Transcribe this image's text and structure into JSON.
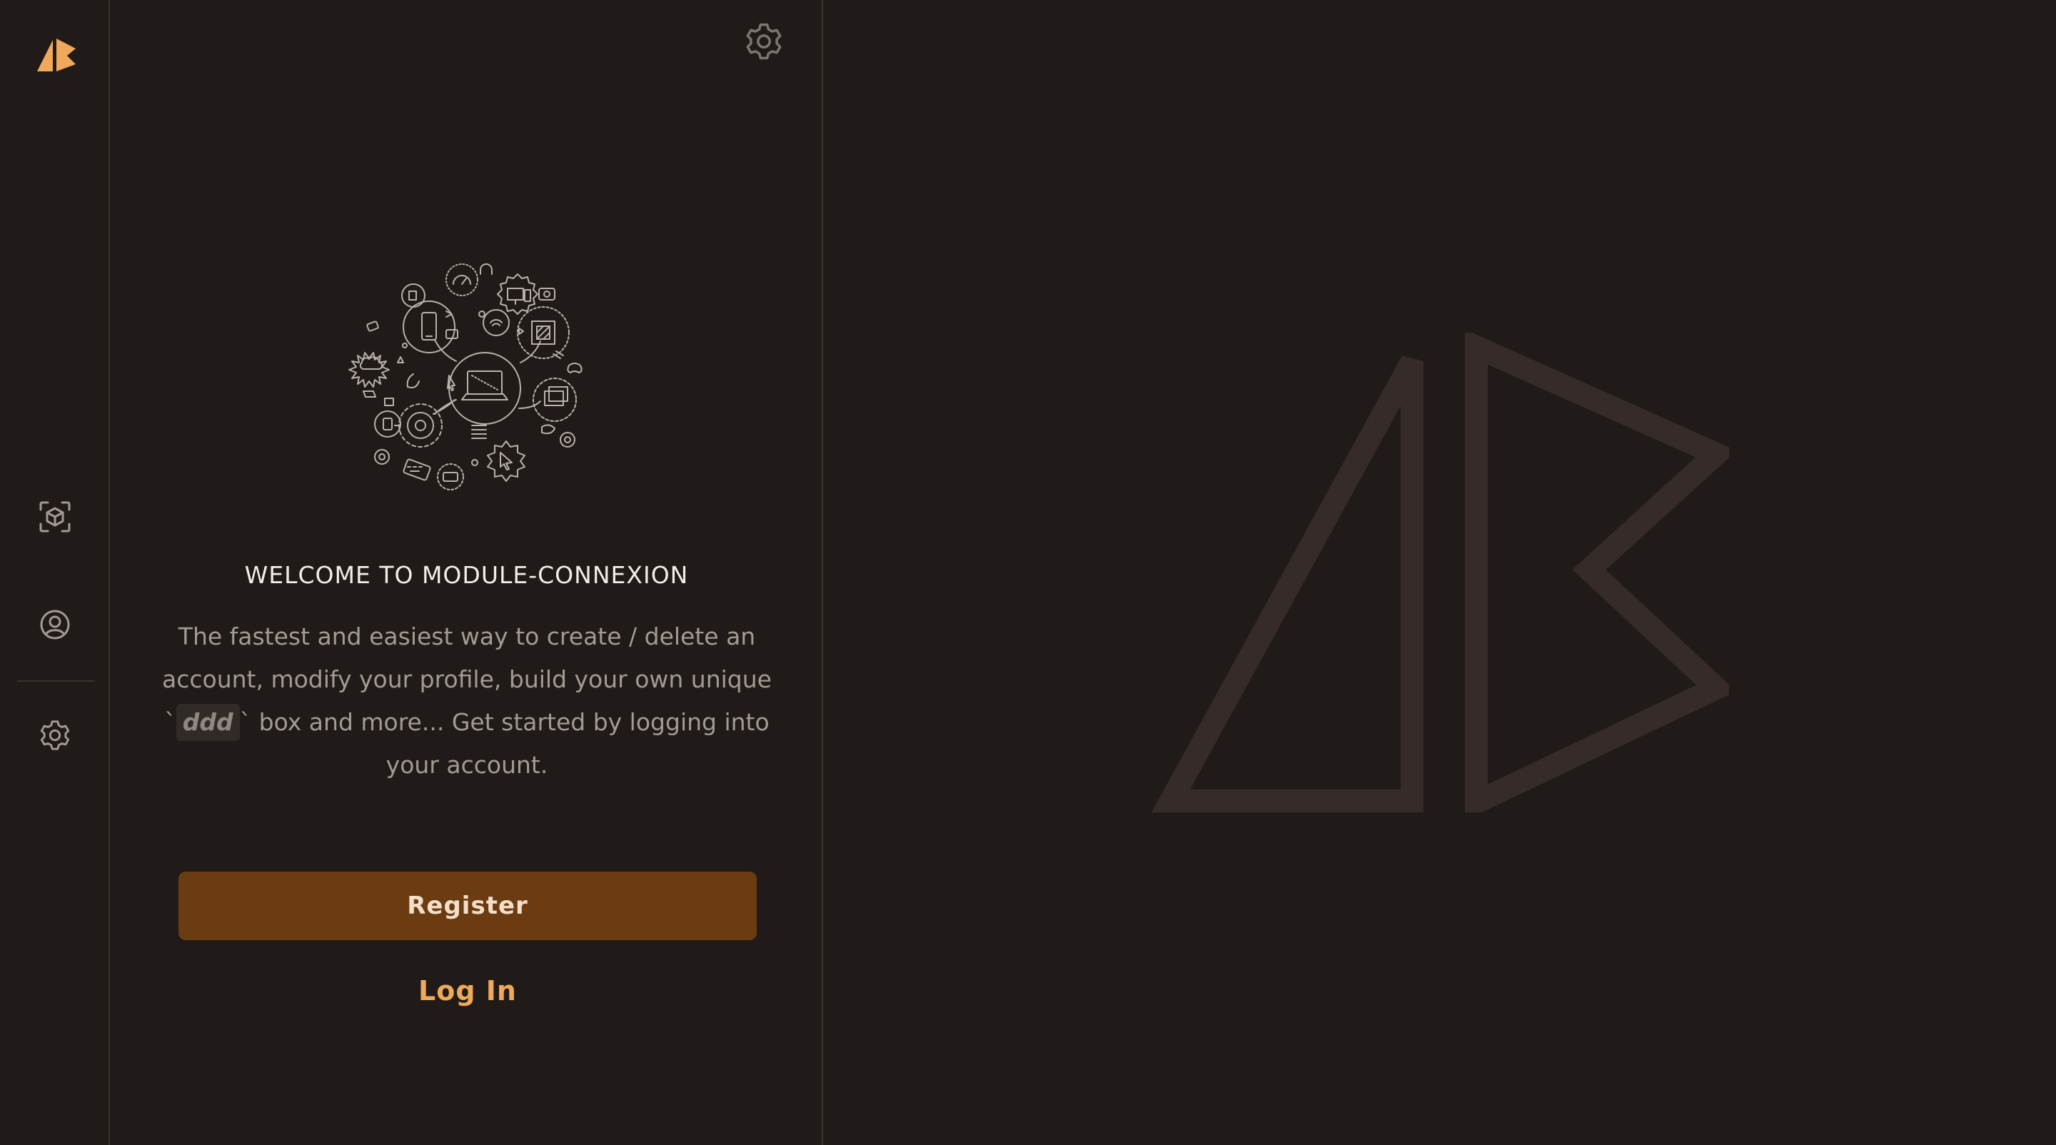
{
  "app": {
    "name": "Module-Connexion",
    "accent_color": "#f0a85a",
    "background_color": "#201b18"
  },
  "rail": {
    "logo_icon": "brand-logo-icon",
    "items": [
      {
        "icon": "cube-scan-icon",
        "label": "Box builder"
      },
      {
        "icon": "user-circle-icon",
        "label": "Profile"
      },
      {
        "icon": "gear-icon",
        "label": "Settings"
      }
    ]
  },
  "panel": {
    "settings_icon": "gear-icon",
    "illustration": "tech-devices-illustration",
    "title": "WELCOME TO MODULE-CONNEXION",
    "desc_before": "The fastest and easiest way to create / delete an account, modify your profile, build your own unique `",
    "desc_code": "ddd",
    "desc_after": "` box and more... Get started by logging into your account.",
    "register_label": "Register",
    "login_label": "Log In",
    "register_color": "#6b3c12"
  },
  "hero": {
    "logo_icon": "brand-logo-outline-icon",
    "stroke_color": "#352b28"
  }
}
